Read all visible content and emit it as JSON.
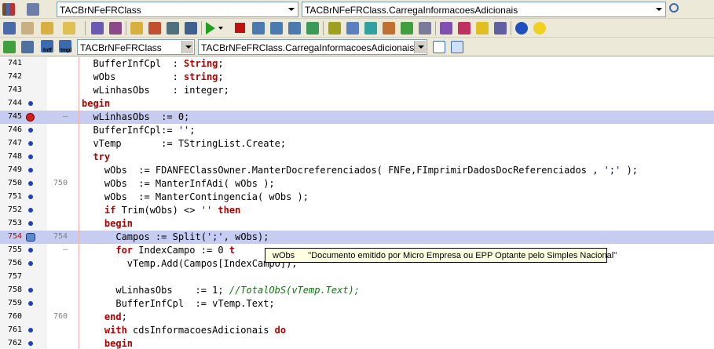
{
  "toolbar": {
    "class_combo": "TACBrNFeFRClass",
    "method_combo": "TACBrNFeFRClass.CarregaInformacoesAdicionais",
    "nav_class_combo": "TACBrNFeFRClass",
    "nav_method_combo": "TACBrNFeFRClass.CarregaInformacoesAdicionais",
    "intf_label": "Intf",
    "impl_label": "Impl"
  },
  "editor": {
    "lines": [
      {
        "num": "741",
        "aux": "",
        "marker": "none",
        "hl": false,
        "html": "  BufferInfCpl  : <span class=\"kw\">String</span>;"
      },
      {
        "num": "742",
        "aux": "",
        "marker": "none",
        "hl": false,
        "html": "  wObs          : <span class=\"kw\">string</span>;"
      },
      {
        "num": "743",
        "aux": "",
        "marker": "none",
        "hl": false,
        "html": "  wLinhasObs    : integer;"
      },
      {
        "num": "744",
        "aux": "",
        "marker": "dot",
        "hl": false,
        "html": "<span class=\"kw\">begin</span>"
      },
      {
        "num": "745",
        "aux": "–",
        "marker": "check",
        "hl": true,
        "html": "  wLinhasObs  := 0;"
      },
      {
        "num": "746",
        "aux": "",
        "marker": "dot",
        "hl": false,
        "html": "  BufferInfCpl:= <span class=\"str\">''</span>;"
      },
      {
        "num": "747",
        "aux": "",
        "marker": "dot",
        "hl": false,
        "html": "  vTemp       := TStringList.Create;"
      },
      {
        "num": "748",
        "aux": "",
        "marker": "dot",
        "hl": false,
        "html": "  <span class=\"kw\">try</span>"
      },
      {
        "num": "749",
        "aux": "",
        "marker": "dot",
        "hl": false,
        "html": "    wObs  := FDANFEClassOwner.ManterDocreferenciados( FNFe,FImprimirDadosDocReferenciados , <span class=\"str\">';'</span> );"
      },
      {
        "num": "750",
        "aux": "750",
        "marker": "dot",
        "hl": false,
        "html": "    wObs  := ManterInfAdi( wObs );"
      },
      {
        "num": "751",
        "aux": "",
        "marker": "dot",
        "hl": false,
        "html": "    wObs  := ManterContingencia( wObs );"
      },
      {
        "num": "752",
        "aux": "",
        "marker": "dot",
        "hl": false,
        "html": "    <span class=\"kw\">if</span> Trim(wObs) &lt;&gt; <span class=\"str\">''</span> <span class=\"kw\">then</span>"
      },
      {
        "num": "753",
        "aux": "",
        "marker": "dot",
        "hl": false,
        "html": "    <span class=\"kw\">begin</span>"
      },
      {
        "num": "754",
        "aux": "754",
        "marker": "arrow",
        "hl": true,
        "err": true,
        "html": "      Campos := Split(<span class=\"str\">';'</span>, wObs);"
      },
      {
        "num": "755",
        "aux": "–",
        "marker": "dot",
        "hl": false,
        "html": "      <span class=\"kw\">for</span> IndexCampo := 0 <span class=\"kw\">t</span>"
      },
      {
        "num": "756",
        "aux": "",
        "marker": "dot",
        "hl": false,
        "html": "        vTemp.Add(Campos[IndexCampo]);"
      },
      {
        "num": "757",
        "aux": "",
        "marker": "none",
        "hl": false,
        "html": ""
      },
      {
        "num": "758",
        "aux": "",
        "marker": "dot",
        "hl": false,
        "html": "      wLinhasObs    := 1; <span class=\"cmt\">//TotalObS(vTemp.Text);</span>"
      },
      {
        "num": "759",
        "aux": "",
        "marker": "dot",
        "hl": false,
        "html": "      BufferInfCpl  := vTemp.Text;"
      },
      {
        "num": "760",
        "aux": "760",
        "marker": "none",
        "hl": false,
        "html": "    <span class=\"kw\">end</span>;"
      },
      {
        "num": "761",
        "aux": "",
        "marker": "dot",
        "hl": false,
        "html": "    <span class=\"kw\">with</span> cdsInformacoesAdicionais <span class=\"kw\">do</span>"
      },
      {
        "num": "762",
        "aux": "",
        "marker": "dot",
        "hl": false,
        "html": "    <span class=\"kw\">begin</span>"
      }
    ]
  },
  "tooltip": {
    "name": "wObs",
    "value": "''Documento emitido por Micro Empresa ou EPP Optante pelo Simples Nacional''"
  },
  "colors": {
    "keyword": "#b00000",
    "highlight": "#c6cdf0",
    "breakpoint_dot": "#1f3fbf",
    "comment": "#008000"
  }
}
